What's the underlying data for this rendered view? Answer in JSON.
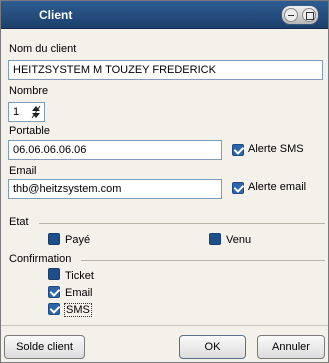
{
  "window": {
    "title": "Client"
  },
  "fields": {
    "nom_label": "Nom du client",
    "nom_value": "HEITZSYSTEM M TOUZEY FREDERICK",
    "nombre_label": "Nombre",
    "nombre_value": "1",
    "portable_label": "Portable",
    "portable_value": "06.06.06.06.06",
    "email_label": "Email",
    "email_value": "thb@heitzsystem.com"
  },
  "checks": {
    "alerte_sms": {
      "label": "Alerte SMS",
      "checked": true
    },
    "alerte_email": {
      "label": "Alerte email",
      "checked": true
    }
  },
  "etat": {
    "label": "Etat",
    "paye": {
      "label": "Payé",
      "checked": false
    },
    "venu": {
      "label": "Venu",
      "checked": false
    }
  },
  "confirmation": {
    "label": "Confirmation",
    "ticket": {
      "label": "Ticket",
      "checked": false
    },
    "email": {
      "label": "Email",
      "checked": true
    },
    "sms": {
      "label": "SMS",
      "checked": true
    }
  },
  "buttons": {
    "solde_client": "Solde client",
    "ok": "OK",
    "annuler": "Annuler"
  },
  "colors": {
    "title_bar": "#1b3f6c",
    "accent": "#2e65a9"
  },
  "icons": {
    "spinner": "up-down-arrows-icon"
  }
}
